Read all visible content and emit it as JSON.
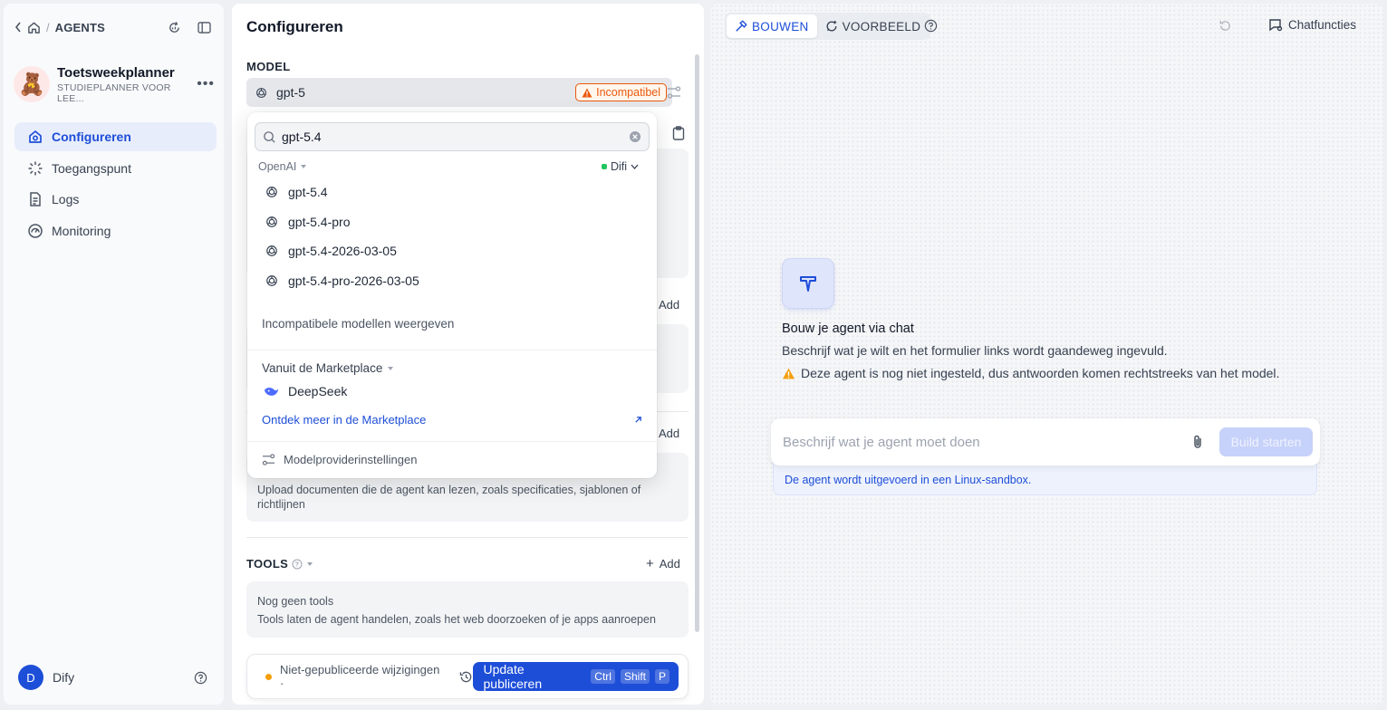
{
  "topbar": {
    "breadcrumb": "AGENTS"
  },
  "app": {
    "name": "Toetsweekplanner",
    "subtitle": "STUDIEPLANNER VOOR LEE...",
    "emoji": "🧸"
  },
  "nav": [
    {
      "label": "Configureren",
      "icon": "configure-icon",
      "active": true
    },
    {
      "label": "Toegangspunt",
      "icon": "access-point-icon"
    },
    {
      "label": "Logs",
      "icon": "logs-icon"
    },
    {
      "label": "Monitoring",
      "icon": "monitoring-icon"
    }
  ],
  "user": {
    "initial": "D",
    "name": "Dify"
  },
  "config": {
    "title": "Configureren",
    "model_label": "MODEL",
    "current_model": "gpt-5",
    "incompatible_badge": "Incompatibel",
    "add_label": "Add",
    "knowledge_help": "Upload documenten die de agent kan lezen, zoals specificaties, sjablonen of richtlijnen",
    "tools_label": "TOOLS",
    "tools_empty_title": "Nog geen tools",
    "tools_empty_desc": "Tools laten de agent handelen, zoals het web doorzoeken of je apps aanroepen",
    "unpublished": "Niet-gepubliceerde wijzigingen ·",
    "publish_label": "Update publiceren",
    "shortcut": [
      "Ctrl",
      "Shift",
      "P"
    ]
  },
  "dropdown": {
    "search_value": "gpt-5.4",
    "provider": "OpenAI",
    "provider_source": "Difi",
    "models": [
      "gpt-5.4",
      "gpt-5.4-pro",
      "gpt-5.4-2026-03-05",
      "gpt-5.4-pro-2026-03-05"
    ],
    "show_incompatible": "Incompatibele modellen weergeven",
    "marketplace_header": "Vanuit de Marketplace",
    "marketplace_item": "DeepSeek",
    "marketplace_link": "Ontdek meer in de Marketplace",
    "provider_settings": "Modelproviderinstellingen"
  },
  "preview": {
    "tab_build": "BOUWEN",
    "tab_preview": "VOORBEELD",
    "chat_features": "Chatfuncties",
    "title": "Bouw je agent via chat",
    "description": "Beschrijf wat je wilt en het formulier links wordt gaandeweg ingevuld.",
    "warning": "Deze agent is nog niet ingesteld, dus antwoorden komen rechtstreeks van het model.",
    "input_placeholder": "Beschrijf wat je agent moet doen",
    "build_button": "Build starten",
    "sandbox_note": "De agent wordt uitgevoerd in een Linux-sandbox."
  },
  "colors": {
    "accent": "#1d4ed8",
    "warning": "#ea580c",
    "unpublished_dot": "#f59e0b"
  }
}
